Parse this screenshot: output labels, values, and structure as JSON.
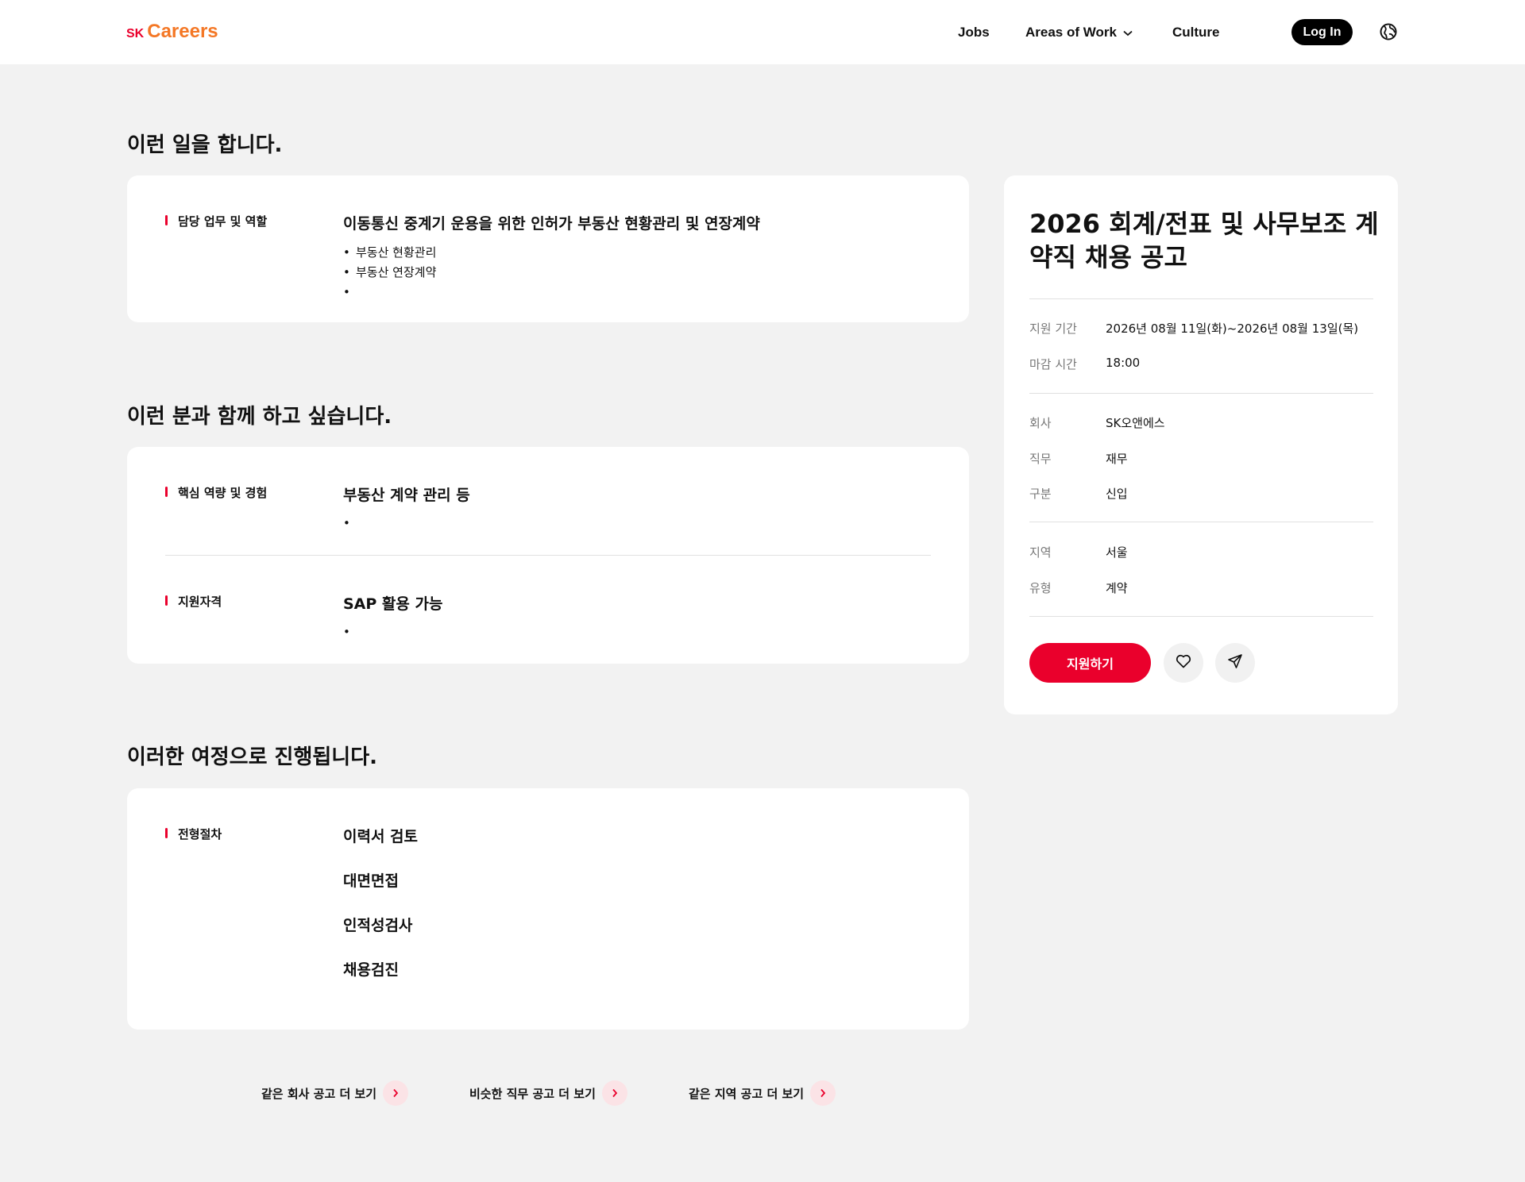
{
  "header": {
    "logo_sk": "SK",
    "logo_careers": "Careers",
    "nav": {
      "jobs": "Jobs",
      "areas": "Areas of Work",
      "culture": "Culture"
    },
    "login": "Log In"
  },
  "sections": {
    "work": {
      "title": "이런 일을 합니다.",
      "label": "담당 업무 및 역할",
      "content_title": "이동통신 중계기 운용을 위한 인허가 부동산 현황관리 및 연장계약",
      "bullets": [
        "부동산 현황관리",
        "부동산 연장계약",
        ""
      ]
    },
    "want": {
      "title": "이런 분과 함께 하고 싶습니다.",
      "core_label": "핵심 역량 및 경험",
      "core_title": "부동산 계약 관리 등",
      "core_bullets": [
        ""
      ],
      "qual_label": "지원자격",
      "qual_title": "SAP 활용 가능",
      "qual_bullets": [
        ""
      ]
    },
    "process": {
      "title": "이러한 여정으로 진행됩니다.",
      "label": "전형절차",
      "steps": [
        "이력서 검토",
        "대면면접",
        "인적성검사",
        "채용검진"
      ]
    }
  },
  "panel": {
    "title": "2026 회계/전표 및 사무보조 계약직 채용 공고",
    "period_label": "지원 기간",
    "period_value": "2026년 08월 11일(화)~2026년 08월 13일(목)",
    "deadline_label": "마감 시간",
    "deadline_value": "18:00",
    "company_label": "회사",
    "company_value": "SK오앤에스",
    "job_label": "직무",
    "job_value": "재무",
    "type_label": "구분",
    "type_value": "신입",
    "region_label": "지역",
    "region_value": "서울",
    "contract_label": "유형",
    "contract_value": "계약",
    "apply": "지원하기"
  },
  "more_links": [
    "같은 회사 공고 더 보기",
    "비슷한 직무 공고 더 보기",
    "같은 지역 공고 더 보기"
  ],
  "colors": {
    "accent": "#ea002c",
    "logo_orange": "#f47725",
    "background": "#f2f2f2"
  },
  "icons": [
    "chevron-down-icon",
    "globe-icon",
    "heart-icon",
    "share-icon",
    "chevron-right-icon"
  ]
}
